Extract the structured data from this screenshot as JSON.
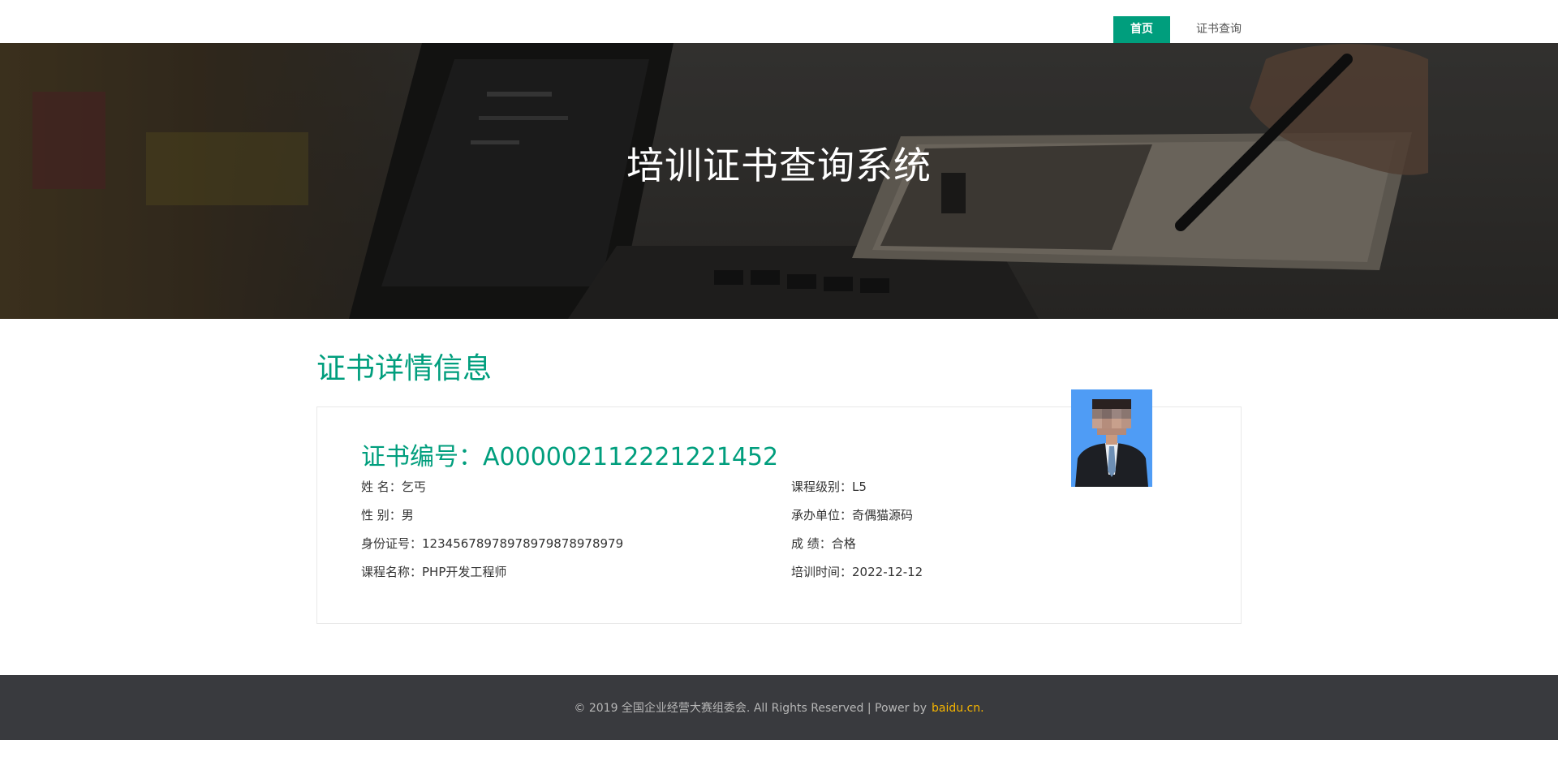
{
  "nav": {
    "home_label": "首页",
    "query_label": "证书查询",
    "active_color": "#009e7d"
  },
  "banner": {
    "title": "培训证书查询系统"
  },
  "section": {
    "title": "证书详情信息"
  },
  "certificate": {
    "number_label": "证书编号：",
    "number": "A000002112221221452",
    "fields_left": [
      {
        "label": "姓 名：",
        "value": "乞丐"
      },
      {
        "label": "性 别：",
        "value": "男"
      },
      {
        "label": "身份证号：",
        "value": "12345678978978979878978979"
      },
      {
        "label": "课程名称：",
        "value": "PHP开发工程师"
      }
    ],
    "fields_right": [
      {
        "label": "课程级别：",
        "value": "L5"
      },
      {
        "label": "承办单位：",
        "value": "奇偶猫源码"
      },
      {
        "label": "成 绩：",
        "value": "合格"
      },
      {
        "label": "培训时间：",
        "value": "2022-12-12"
      }
    ]
  },
  "footer": {
    "text": "© 2019 全国企业经营大赛组委会. All Rights Reserved | Power by",
    "link": "baidu.cn.",
    "link_color": "#f5b400"
  }
}
